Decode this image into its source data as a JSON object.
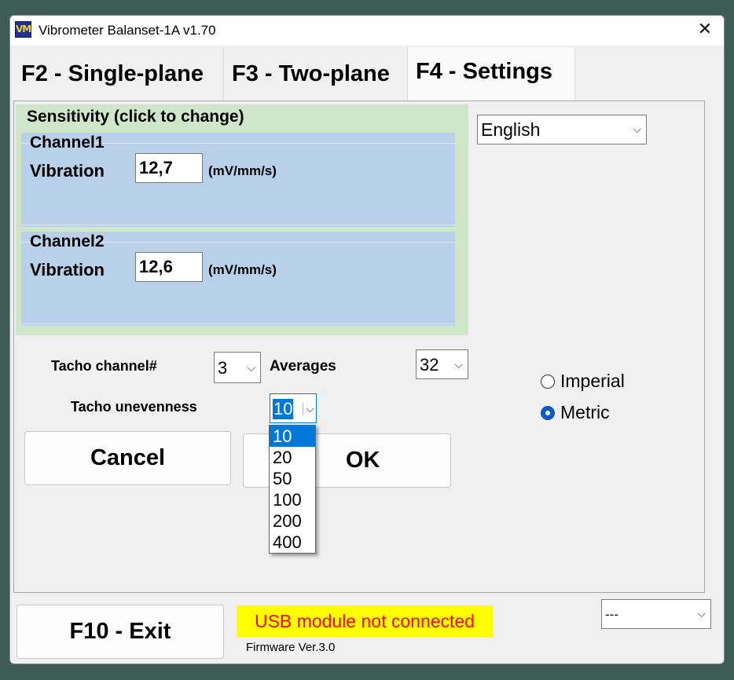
{
  "window": {
    "title": "Vibrometer Balanset-1A  v1.70",
    "app_icon": "VM"
  },
  "tabs": [
    {
      "label": "F2 - Single-plane",
      "active": false
    },
    {
      "label": "F3 - Two-plane",
      "active": false
    },
    {
      "label": "F4 - Settings",
      "active": true
    }
  ],
  "sensitivity": {
    "title": "Sensitivity (click to change)",
    "channel1": {
      "title": "Channel1",
      "label": "Vibration",
      "value": "12,7",
      "unit": "(mV/mm/s)"
    },
    "channel2": {
      "title": "Channel2",
      "label": "Vibration",
      "value": "12,6",
      "unit": "(mV/mm/s)"
    }
  },
  "language": {
    "selected": "English"
  },
  "tacho_channel": {
    "label": "Tacho channel#",
    "value": "3"
  },
  "averages": {
    "label": "Averages",
    "value": "32"
  },
  "tacho_unevenness": {
    "label": "Tacho unevenness",
    "value": "10",
    "options": [
      "10",
      "20",
      "50",
      "100",
      "200",
      "400"
    ],
    "highlighted": "10"
  },
  "buttons": {
    "cancel": "Cancel",
    "ok": "OK",
    "exit": "F10 - Exit"
  },
  "units": {
    "imperial": {
      "label": "Imperial",
      "checked": false
    },
    "metric": {
      "label": "Metric",
      "checked": true
    }
  },
  "status": {
    "message": "USB module not connected",
    "firmware": "Firmware Ver.3.0"
  },
  "bottom_combo": {
    "value": "---"
  },
  "colors": {
    "status_bg": "#ffff00",
    "status_text": "#ff0000",
    "sensitivity_bg": "#cfe6c8",
    "channel_bg": "#b8d0ea",
    "accent": "#0078d7"
  }
}
